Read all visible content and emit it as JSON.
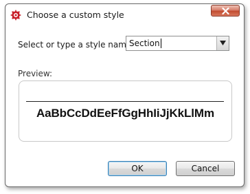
{
  "window": {
    "title": "Choose a custom style",
    "icon": "gear-icon",
    "close_icon": "close-icon",
    "accent_color": "#c8202a"
  },
  "form": {
    "style_label": "Select or type a style name:",
    "style_value": "Section",
    "dropdown_icon": "chevron-down-icon",
    "preview_label": "Preview:",
    "preview_sample": "AaBbCcDdEeFfGgHhIiJjKkLlMm"
  },
  "buttons": {
    "ok_label": "OK",
    "cancel_label": "Cancel"
  }
}
